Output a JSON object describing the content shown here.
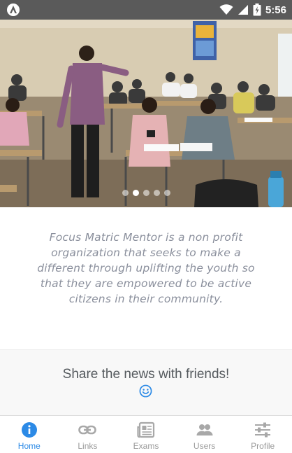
{
  "status_bar": {
    "time": "5:56",
    "icons": [
      "app-logo-icon",
      "wifi-icon",
      "cell-signal-icon",
      "battery-icon"
    ]
  },
  "carousel": {
    "image": "classroom-photo",
    "slide_count": 5,
    "active_index": 1
  },
  "mission_text": "Focus Matric Mentor is a non profit organization that seeks to make a different through uplifting the youth so that they are empowered to be active citizens in their community.",
  "share": {
    "label": "Share the news with friends!",
    "icon": "smiley-icon"
  },
  "nav": {
    "items": [
      {
        "label": "Home",
        "icon": "info-icon",
        "active": true
      },
      {
        "label": "Links",
        "icon": "link-icon",
        "active": false
      },
      {
        "label": "Exams",
        "icon": "newspaper-icon",
        "active": false
      },
      {
        "label": "Users",
        "icon": "users-icon",
        "active": false
      },
      {
        "label": "Profile",
        "icon": "sliders-icon",
        "active": false
      }
    ]
  },
  "colors": {
    "accent": "#2c8ae6",
    "status_bar": "#5a5a5a",
    "inactive": "#9a9a9a",
    "mission_text": "#8a8f9c"
  }
}
